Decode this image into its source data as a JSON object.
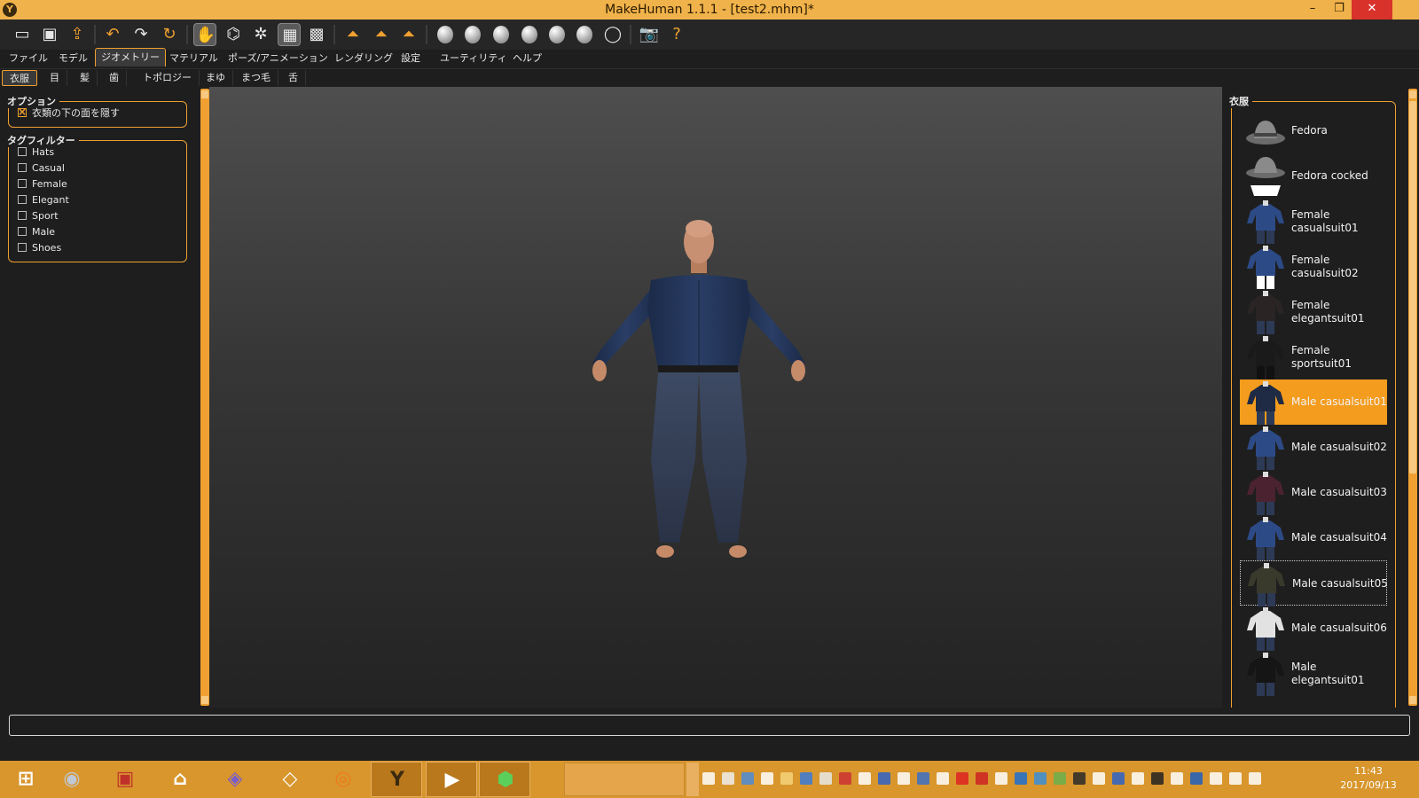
{
  "window": {
    "title": "MakeHuman 1.1.1 - [test2.mhm]*",
    "minimize": "–",
    "restore": "❐",
    "close": "✕"
  },
  "main_tabs": [
    "ファイル",
    "モデル",
    "ジオメトリー",
    "マテリアル",
    "ポーズ/アニメーション",
    "レンダリング",
    "設定",
    "ユーティリティ",
    "ヘルプ"
  ],
  "main_tab_active": "ジオメトリー",
  "sub_tabs": [
    "衣服",
    "目",
    "髪",
    "歯",
    "トポロジー",
    "まゆ",
    "まつ毛",
    "舌"
  ],
  "sub_tab_active": "衣服",
  "options": {
    "title": "オプション",
    "hide_faces_label": "衣類の下の面を隠す",
    "hide_faces_checked": true
  },
  "tag_filter": {
    "title": "タグフィルター",
    "tags": [
      {
        "label": "Hats",
        "checked": false
      },
      {
        "label": "Casual",
        "checked": false
      },
      {
        "label": "Female",
        "checked": false
      },
      {
        "label": "Elegant",
        "checked": false
      },
      {
        "label": "Sport",
        "checked": false
      },
      {
        "label": "Male",
        "checked": false
      },
      {
        "label": "Shoes",
        "checked": false
      }
    ]
  },
  "clothes": {
    "title": "衣服",
    "items": [
      {
        "label": "Fedora",
        "thumb": "hat"
      },
      {
        "label": "Fedora cocked",
        "thumb": "hat-white"
      },
      {
        "label": "Female casualsuit01",
        "thumb": "suit-blue"
      },
      {
        "label": "Female casualsuit02",
        "thumb": "suit-blue-white"
      },
      {
        "label": "Female elegantsuit01",
        "thumb": "suit-dark"
      },
      {
        "label": "Female sportsuit01",
        "thumb": "suit-sport"
      },
      {
        "label": "Male casualsuit01",
        "thumb": "suit-navy",
        "selected": true
      },
      {
        "label": "Male casualsuit02",
        "thumb": "suit-blue"
      },
      {
        "label": "Male casualsuit03",
        "thumb": "suit-maroon"
      },
      {
        "label": "Male casualsuit04",
        "thumb": "suit-blue"
      },
      {
        "label": "Male casualsuit05",
        "thumb": "suit-olive",
        "focused": true
      },
      {
        "label": "Male casualsuit06",
        "thumb": "suit-white"
      },
      {
        "label": "Male elegantsuit01",
        "thumb": "suit-black"
      }
    ]
  },
  "status_text": "",
  "taskbar": {
    "clock_time": "11:43",
    "clock_date": "2017/09/13"
  }
}
